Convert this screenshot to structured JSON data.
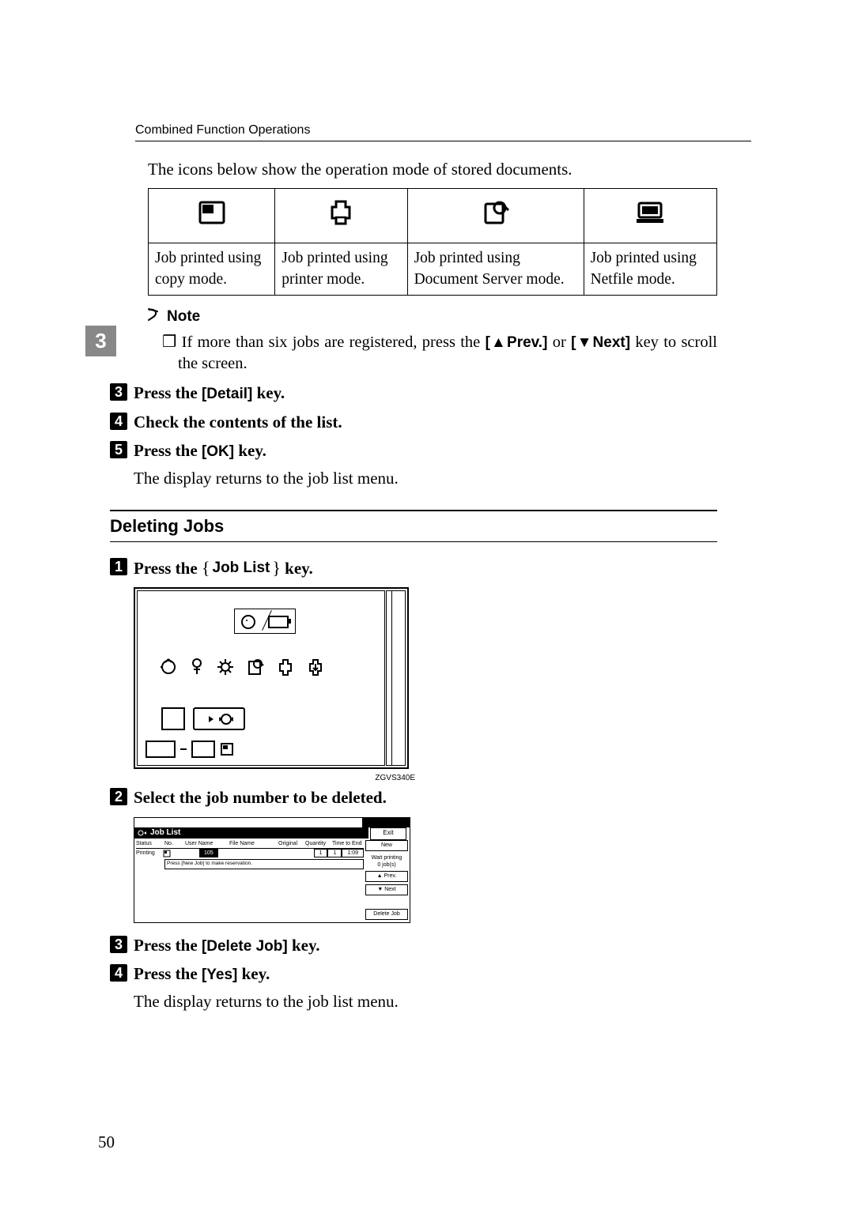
{
  "header": "Combined Function Operations",
  "intro": "The icons below show the operation mode of stored documents.",
  "table": {
    "captions": [
      "Job printed using copy mode.",
      "Job printed using printer mode.",
      "Job printed using Document Server mode.",
      "Job printed using Netfile mode."
    ]
  },
  "note": {
    "label": "Note",
    "item": {
      "pre": "If more than six jobs are registered, press the ",
      "prev": "[▲Prev.]",
      "mid": " or ",
      "next": "[▼Next]",
      "post": " key to scroll the screen."
    }
  },
  "steps_a": {
    "s3": {
      "pre": "Press the ",
      "key": "[Detail]",
      "post": " key."
    },
    "s4": "Check the contents of the list.",
    "s5": {
      "pre": "Press the ",
      "key": "[OK]",
      "post": " key."
    },
    "s5_body": "The display returns to the job list menu."
  },
  "section_heading": "Deleting Jobs",
  "steps_b": {
    "s1": {
      "pre": "Press the ",
      "key": "Job List",
      "post": " key."
    },
    "s2": "Select the job number to be deleted.",
    "s3": {
      "pre": "Press the ",
      "key": "[Delete Job]",
      "post": " key."
    },
    "s4": {
      "pre": "Press the ",
      "key": "[Yes]",
      "post": " key."
    },
    "s4_body": "The display returns to the job list menu."
  },
  "fig_label": "ZGVS340E",
  "screen": {
    "title": "Job List",
    "exit": "Exit",
    "cols": {
      "status": "Status",
      "no": "No.",
      "user": "User Name",
      "file": "File Name",
      "orig": "Original",
      "qty": "Quantity",
      "time": "Time to End"
    },
    "row": {
      "status": "Printing",
      "no": "105",
      "orig": "1",
      "qty": "1",
      "time": "1:09"
    },
    "row2": "Press [New Job] to make reservation.",
    "new": "New",
    "waiting1": "Wait printing",
    "waiting2": "0 job(s)",
    "prev": "▲ Prev.",
    "next": "▼ Next",
    "delete": "Delete Job"
  },
  "sidebar_chapter": "3",
  "page_number": "50"
}
